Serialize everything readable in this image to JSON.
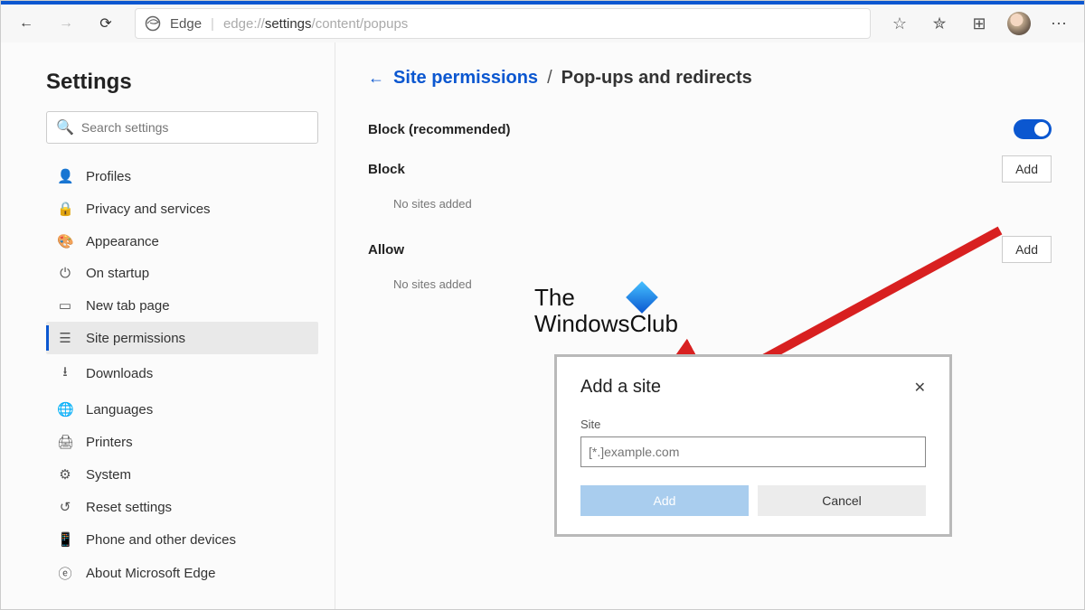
{
  "toolbar": {
    "edge_label": "Edge",
    "url_dim_prefix": "edge://",
    "url_strong": "settings",
    "url_dim_suffix": "/content/popups"
  },
  "sidebar": {
    "title": "Settings",
    "search_placeholder": "Search settings",
    "items": [
      {
        "icon": "👤",
        "label": "Profiles"
      },
      {
        "icon": "🔒",
        "label": "Privacy and services"
      },
      {
        "icon": "🎨",
        "label": "Appearance"
      },
      {
        "icon": "⏻",
        "label": "On startup"
      },
      {
        "icon": "▭",
        "label": "New tab page"
      },
      {
        "icon": "☰",
        "label": "Site permissions"
      },
      {
        "icon": "⭳",
        "label": "Downloads"
      },
      {
        "icon": "🌐",
        "label": "Languages"
      },
      {
        "icon": "🖨",
        "label": "Printers"
      },
      {
        "icon": "⚙",
        "label": "System"
      },
      {
        "icon": "↺",
        "label": "Reset settings"
      },
      {
        "icon": "📱",
        "label": "Phone and other devices"
      },
      {
        "icon": "ⓔ",
        "label": "About Microsoft Edge"
      }
    ]
  },
  "main": {
    "breadcrumb_link": "Site permissions",
    "breadcrumb_sep": "/",
    "breadcrumb_current": "Pop-ups and redirects",
    "block_recommended": "Block (recommended)",
    "block_title": "Block",
    "allow_title": "Allow",
    "no_sites": "No sites added",
    "add_button": "Add"
  },
  "dialog": {
    "title": "Add a site",
    "field_label": "Site",
    "placeholder": "[*.]example.com",
    "add": "Add",
    "cancel": "Cancel"
  },
  "watermark": {
    "line1": "The",
    "line2": "WindowsClub"
  }
}
